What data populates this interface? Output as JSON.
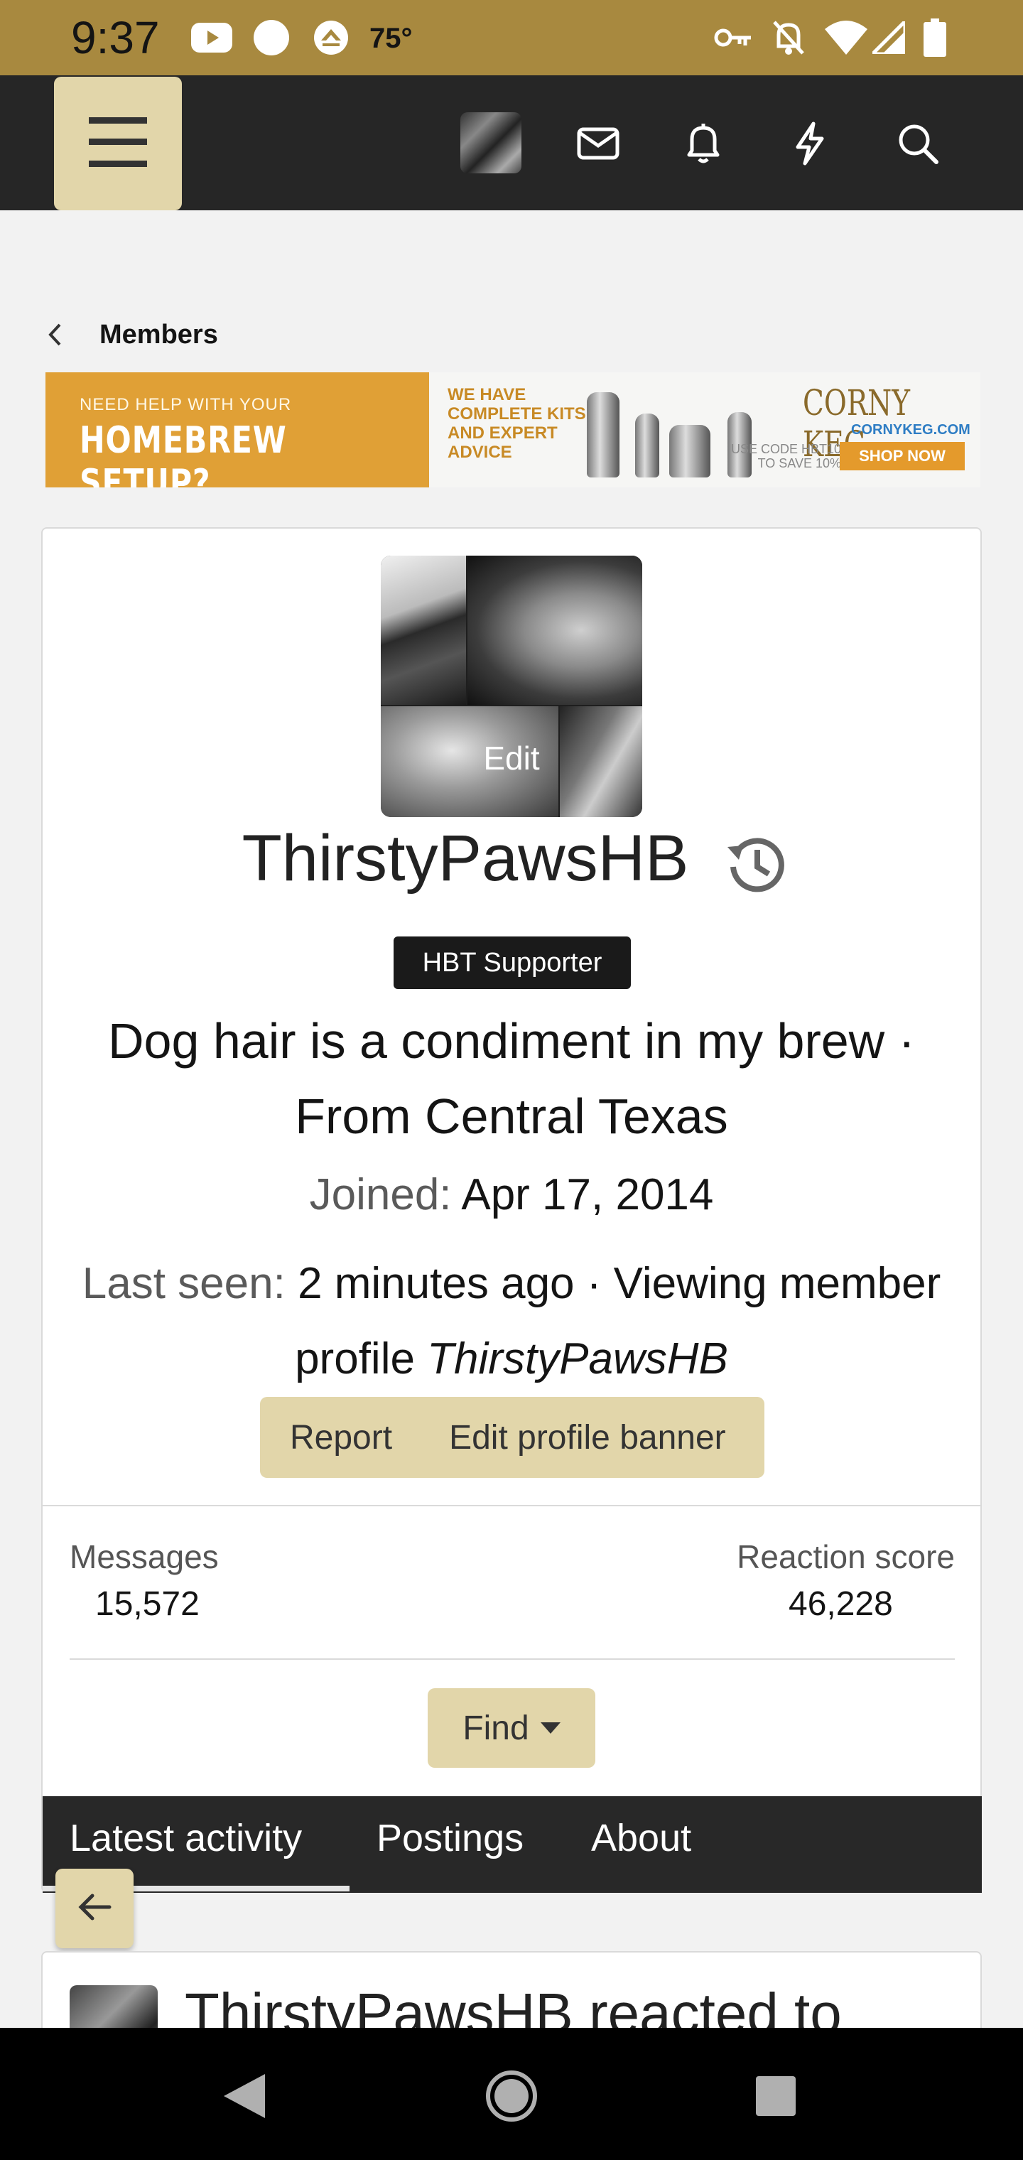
{
  "status_bar": {
    "time": "9:37",
    "temperature": "75°",
    "icons": [
      "youtube-icon",
      "circle-icon",
      "weather-icon",
      "vpn-key-icon",
      "bell-off-icon",
      "wifi-icon",
      "cellular-signal-icon",
      "battery-icon"
    ]
  },
  "header": {
    "icons": [
      "menu-icon",
      "avatar",
      "mail-icon",
      "bell-icon",
      "lightning-icon",
      "search-icon"
    ]
  },
  "breadcrumb": {
    "label": "Members"
  },
  "ad_banner": {
    "small_text": "NEED HELP WITH YOUR",
    "headline": "HOMEBREW SETUP?",
    "kits_text": "WE HAVE COMPLETE KITS AND EXPERT ADVICE",
    "brand": "CORNY KEG",
    "url": "CORNYKEG.COM",
    "promo": "USE CODE HBT10 TO SAVE 10%",
    "cta": "SHOP NOW"
  },
  "profile": {
    "avatar_edit_label": "Edit",
    "username": "ThirstyPawsHB",
    "badge": "HBT Supporter",
    "tagline": "Dog hair is a condiment in my brew · From Central Texas",
    "joined_label": "Joined:",
    "joined_value": "Apr 17, 2014",
    "last_seen_label": "Last seen:",
    "last_seen_value": "2 minutes ago · Viewing member profile ",
    "last_seen_profile": "ThirstyPawsHB",
    "report_label": "Report",
    "edit_banner_label": "Edit profile banner",
    "messages_label": "Messages",
    "messages_value": "15,572",
    "reaction_label": "Reaction score",
    "reaction_value": "46,228",
    "find_label": "Find"
  },
  "tabs": [
    {
      "label": "Latest activity",
      "active": true
    },
    {
      "label": "Postings",
      "active": false
    },
    {
      "label": "About",
      "active": false
    }
  ],
  "activity": {
    "first_item_text": "ThirstyPawsHB reacted to"
  },
  "colors": {
    "status_bar": "#a8893f",
    "header": "#262626",
    "accent_button": "#e2d6aa",
    "tab_bar": "#282828"
  }
}
